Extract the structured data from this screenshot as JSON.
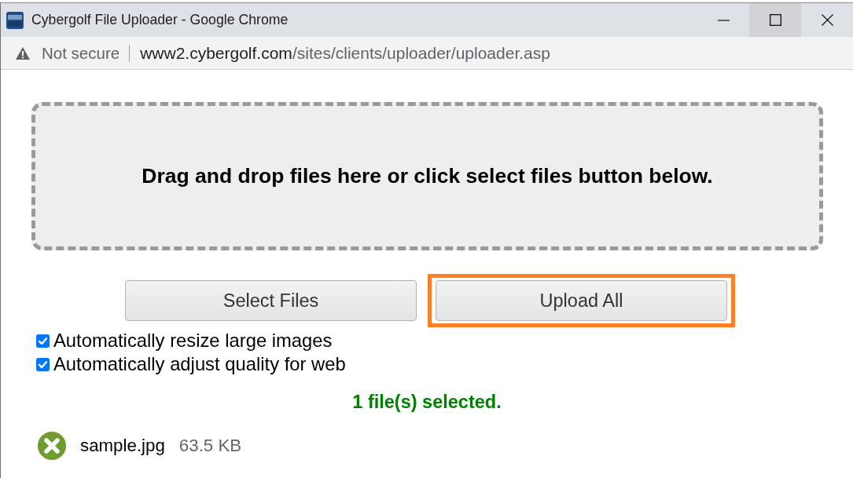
{
  "window": {
    "title": "Cybergolf File Uploader - Google Chrome",
    "controls": [
      {
        "kind": "minimize",
        "hovered": false
      },
      {
        "kind": "maximize",
        "hovered": true
      },
      {
        "kind": "close",
        "hovered": false
      }
    ]
  },
  "address_bar": {
    "security_label": "Not secure",
    "url_host": "www2.cybergolf.com",
    "url_path": "/sites/clients/uploader/uploader.asp"
  },
  "drop_zone": {
    "text": "Drag and drop files here or click select files button below."
  },
  "buttons": [
    {
      "label": "Select Files",
      "highlighted": false
    },
    {
      "label": "Upload All",
      "highlighted": true
    }
  ],
  "options": [
    {
      "label": "Automatically resize large images",
      "checked": true
    },
    {
      "label": "Automatically adjust quality for web",
      "checked": true
    }
  ],
  "status": {
    "text": "1 file(s) selected."
  },
  "files": [
    {
      "name": "sample.jpg",
      "size": "63.5 KB"
    }
  ]
}
